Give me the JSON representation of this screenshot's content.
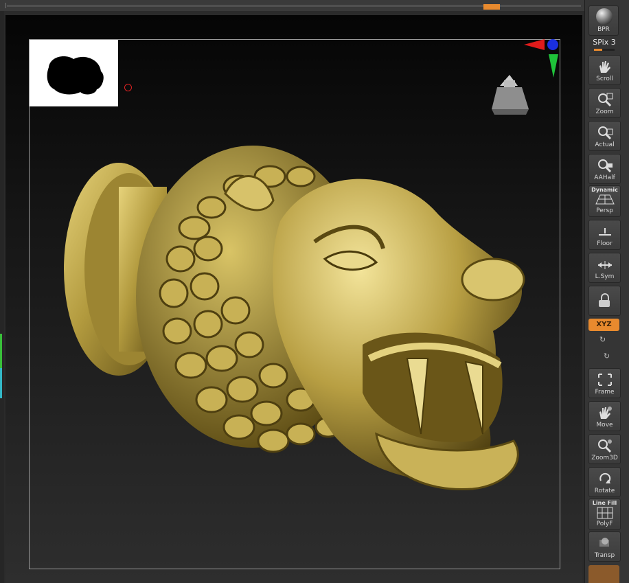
{
  "viewport": {
    "background_top": "#050505",
    "background_bottom": "#2e2e2e",
    "model_color": "#b9a24a",
    "model_name": "lion-head-knob"
  },
  "accent_color": "#e88a2e",
  "shelf": {
    "bpr": {
      "label": "BPR",
      "icon": "bpr-sphere-icon"
    },
    "spix": {
      "label": "SPix 3"
    },
    "buttons": [
      {
        "key": "scroll",
        "label": "Scroll",
        "icon": "hand-icon"
      },
      {
        "key": "zoom",
        "label": "Zoom",
        "icon": "magnifier-icon"
      },
      {
        "key": "actual",
        "label": "Actual",
        "icon": "magnifier-icon"
      },
      {
        "key": "aahalf",
        "label": "AAHalf",
        "icon": "magnifier-icon"
      },
      {
        "key": "persp",
        "label": "Persp",
        "top_label": "Dynamic",
        "icon": "perspective-grid-icon"
      },
      {
        "key": "floor",
        "label": "Floor",
        "icon": "floor-icon"
      },
      {
        "key": "lsym",
        "label": "L.Sym",
        "icon": "symmetry-arrows-icon"
      },
      {
        "key": "lock",
        "label": "",
        "icon": "lock-camera-icon"
      }
    ],
    "xyz": {
      "label": "XYZ"
    },
    "rotate_y_icon": "y-rotate-icon",
    "rotate_z_icon": "z-rotate-icon",
    "buttons2": [
      {
        "key": "frame",
        "label": "Frame",
        "icon": "frame-icon"
      },
      {
        "key": "move",
        "label": "Move",
        "icon": "hand-icon"
      },
      {
        "key": "zoom3d",
        "label": "Zoom3D",
        "icon": "magnifier-icon"
      },
      {
        "key": "rotate",
        "label": "Rotate",
        "icon": "rotate-icon"
      },
      {
        "key": "polyf",
        "label": "PolyF",
        "top_label": "Line Fill",
        "icon": "polyframe-grid-icon"
      },
      {
        "key": "transp",
        "label": "Transp",
        "icon": "transparency-icon"
      }
    ]
  }
}
